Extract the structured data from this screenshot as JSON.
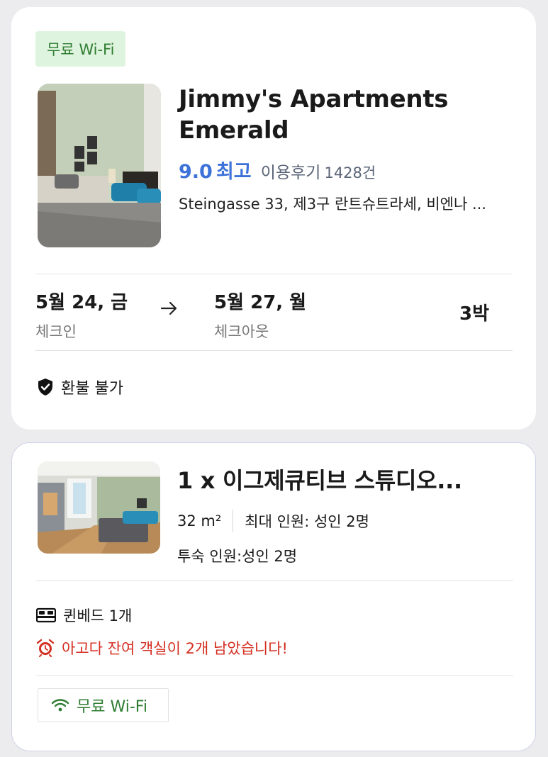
{
  "hotel": {
    "badge": "무료 Wi-Fi",
    "name": "Jimmy's Apartments Emerald",
    "rating_score": "9.0",
    "rating_word": "최고",
    "review_label": "이용후기",
    "review_count": "1428건",
    "address": "Steingasse 33, 제3구 란트슈트라세, 비엔나 ...",
    "checkin_date": "5월 24, 금",
    "checkin_label": "체크인",
    "checkout_date": "5월 27, 월",
    "checkout_label": "체크아웃",
    "nights": "3박",
    "refund_policy": "환불 불가"
  },
  "room": {
    "title": "1 x 이그제큐티브 스튜디오...",
    "size": "32 m²",
    "max_occupancy": "최대 인원: 성인 2명",
    "guests": "투숙 인원:성인 2명",
    "bed": "퀸베드 1개",
    "alert": "아고다 잔여 객실이 2개 남았습니다!",
    "wifi": "무료 Wi-Fi"
  },
  "colors": {
    "accent_blue": "#3d72d8",
    "alert_red": "#d42e20",
    "wifi_green": "#2f7d32",
    "badge_bg": "#dff4de"
  },
  "icons": [
    "arrow-right-icon",
    "shield-check-icon",
    "bed-icon",
    "alarm-clock-icon",
    "wifi-icon"
  ]
}
